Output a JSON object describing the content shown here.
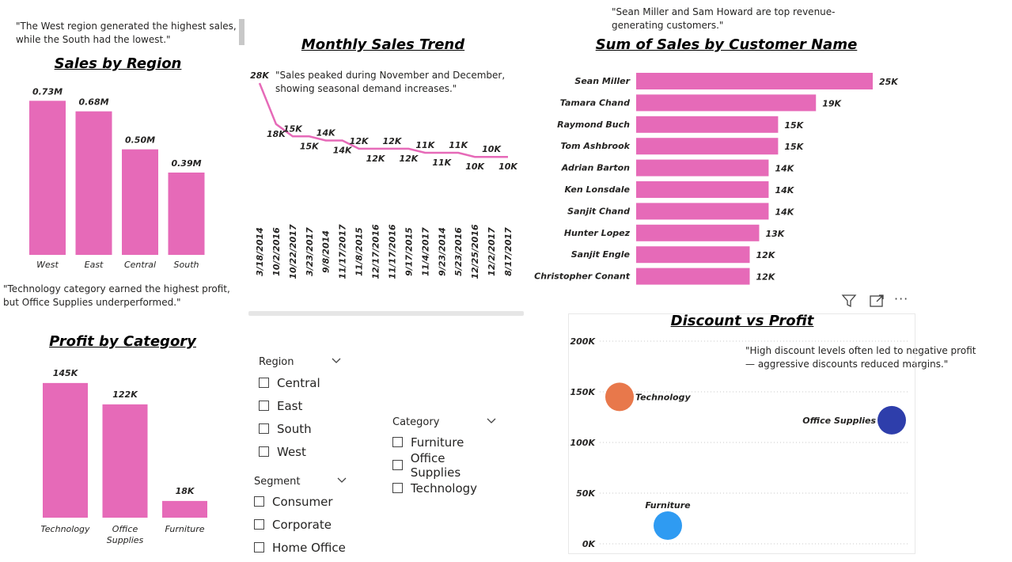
{
  "notes": {
    "region": "\"The West region generated the highest sales, while the South had the lowest.\"",
    "customers": "\"Sean Miller and Sam Howard are top revenue-generating customers.\"",
    "trend": "\"Sales peaked during November and December, showing seasonal demand increases.\"",
    "category": "\"Technology category earned the highest profit, but Office Supplies underperformed.\"",
    "discount": "\"High discount levels often led to negative profit — aggressive discounts reduced margins.\""
  },
  "toolbar": {
    "filter_icon": "filter-icon",
    "focus_icon": "focus-mode-icon",
    "more_icon": "more-options-icon",
    "more_label": "···"
  },
  "slicers": {
    "region": {
      "title": "Region",
      "items": [
        "Central",
        "East",
        "South",
        "West"
      ]
    },
    "segment": {
      "title": "Segment",
      "items": [
        "Consumer",
        "Corporate",
        "Home Office"
      ]
    },
    "category": {
      "title": "Category",
      "items": [
        "Furniture",
        "Office Supplies",
        "Technology"
      ]
    }
  },
  "colors": {
    "bar": "#e66ab8",
    "line": "#e66ab8",
    "tech": "#e8784b",
    "office": "#2e3eab",
    "furniture": "#2f9bf2"
  },
  "chart_data": [
    {
      "id": "sales_by_region",
      "type": "bar",
      "title": "Sales by Region",
      "categories": [
        "West",
        "East",
        "Central",
        "South"
      ],
      "values": [
        0.73,
        0.68,
        0.5,
        0.39
      ],
      "data_labels": [
        "0.73M",
        "0.68M",
        "0.50M",
        "0.39M"
      ],
      "unit": "M",
      "ylim": [
        0,
        0.75
      ]
    },
    {
      "id": "monthly_sales_trend",
      "type": "line",
      "title": "Monthly Sales Trend",
      "categories": [
        "3/18/2014",
        "10/2/2016",
        "10/22/2017",
        "3/23/2017",
        "9/8/2014",
        "11/17/2017",
        "11/8/2015",
        "12/17/2016",
        "11/17/2016",
        "9/17/2015",
        "11/4/2017",
        "9/23/2014",
        "5/23/2016",
        "12/25/2016",
        "12/2/2017",
        "8/17/2017"
      ],
      "values": [
        28,
        18,
        15,
        15,
        14,
        14,
        12,
        12,
        12,
        12,
        11,
        11,
        11,
        10,
        10,
        10
      ],
      "data_labels": [
        "28K",
        "18K",
        "15K",
        "15K",
        "14K",
        "14K",
        "12K",
        "12K",
        "12K",
        "12K",
        "11K",
        "11K",
        "11K",
        "10K",
        "10K",
        "10K"
      ],
      "unit": "K"
    },
    {
      "id": "sales_by_customer",
      "type": "bar",
      "orientation": "horizontal",
      "title": "Sum of Sales by Customer Name",
      "categories": [
        "Sean Miller",
        "Tamara Chand",
        "Raymond Buch",
        "Tom Ashbrook",
        "Adrian Barton",
        "Ken Lonsdale",
        "Sanjit Chand",
        "Hunter Lopez",
        "Sanjit Engle",
        "Christopher Conant"
      ],
      "values": [
        25,
        19,
        15,
        15,
        14,
        14,
        14,
        13,
        12,
        12
      ],
      "data_labels": [
        "25K",
        "19K",
        "15K",
        "15K",
        "14K",
        "14K",
        "14K",
        "13K",
        "12K",
        "12K"
      ],
      "unit": "K"
    },
    {
      "id": "profit_by_category",
      "type": "bar",
      "title": "Profit by Category",
      "categories": [
        "Technology",
        "Office Supplies",
        "Furniture"
      ],
      "category_lines": [
        [
          "Technology"
        ],
        [
          "Office",
          "Supplies"
        ],
        [
          "Furniture"
        ]
      ],
      "values": [
        145,
        122,
        18
      ],
      "data_labels": [
        "145K",
        "122K",
        "18K"
      ],
      "unit": "K",
      "ylim": [
        0,
        150
      ]
    },
    {
      "id": "discount_vs_profit",
      "type": "scatter",
      "title": "Discount vs Profit",
      "y_ticks": [
        "200K",
        "150K",
        "100K",
        "50K",
        "0K"
      ],
      "y_tick_values": [
        200,
        150,
        100,
        50,
        0
      ],
      "ylim": [
        0,
        200
      ],
      "points": [
        {
          "name": "Technology",
          "y": 145,
          "color": "#e8784b"
        },
        {
          "name": "Office Supplies",
          "y": 122,
          "color": "#2e3eab"
        },
        {
          "name": "Furniture",
          "y": 18,
          "color": "#2f9bf2"
        }
      ]
    }
  ]
}
